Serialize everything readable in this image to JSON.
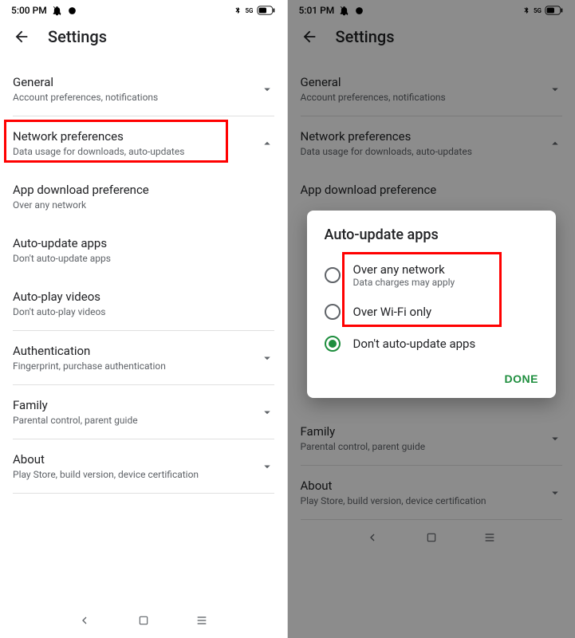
{
  "left": {
    "status": {
      "time": "5:00 PM"
    },
    "header": {
      "title": "Settings"
    },
    "general": {
      "title": "General",
      "sub": "Account preferences, notifications"
    },
    "network": {
      "title": "Network preferences",
      "sub": "Data usage for downloads, auto-updates"
    },
    "appdl": {
      "title": "App download preference",
      "sub": "Over any network"
    },
    "autoupdate": {
      "title": "Auto-update apps",
      "sub": "Don't auto-update apps"
    },
    "autoplay": {
      "title": "Auto-play videos",
      "sub": "Don't auto-play videos"
    },
    "auth": {
      "title": "Authentication",
      "sub": "Fingerprint, purchase authentication"
    },
    "family": {
      "title": "Family",
      "sub": "Parental control, parent guide"
    },
    "about": {
      "title": "About",
      "sub": "Play Store, build version, device certification"
    }
  },
  "right": {
    "status": {
      "time": "5:01 PM"
    },
    "header": {
      "title": "Settings"
    },
    "general": {
      "title": "General",
      "sub": "Account preferences, notifications"
    },
    "network": {
      "title": "Network preferences",
      "sub": "Data usage for downloads, auto-updates"
    },
    "appdl": {
      "title": "App download preference"
    },
    "family": {
      "title": "Family",
      "sub": "Parental control, parent guide"
    },
    "about": {
      "title": "About",
      "sub": "Play Store, build version, device certification"
    },
    "dialog": {
      "title": "Auto-update apps",
      "opt1": {
        "label": "Over any network",
        "sub": "Data charges may apply"
      },
      "opt2": {
        "label": "Over Wi-Fi only"
      },
      "opt3": {
        "label": "Don't auto-update apps"
      },
      "done": "DONE"
    }
  }
}
